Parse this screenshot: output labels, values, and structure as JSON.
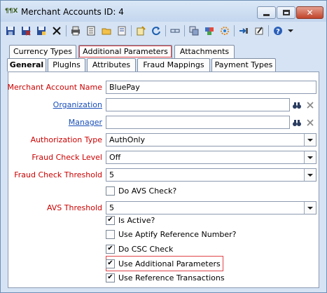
{
  "window": {
    "title": "Merchant Accounts ID: 4",
    "app_icon_text": "¶¶X",
    "minimize_icon": "minimize-icon",
    "maximize_icon": "maximize-icon",
    "close_icon": "close-icon"
  },
  "toolbar": {
    "icons": [
      "save-icon",
      "save-close-icon",
      "save-new-icon",
      "delete-icon",
      "print-icon",
      "print-preview-icon",
      "folder-open-icon",
      "notes-icon",
      "wizard-icon",
      "refresh-icon",
      "link-icon",
      "copy-icon",
      "palette-icon",
      "settings-icon",
      "attach-icon",
      "edit-icon",
      "help-icon",
      "dropdown-icon"
    ]
  },
  "tabs_top": [
    {
      "label": "Currency Types"
    },
    {
      "label": "Additional Parameters"
    },
    {
      "label": "Attachments"
    }
  ],
  "tabs_bottom": [
    {
      "label": "General"
    },
    {
      "label": "PlugIns"
    },
    {
      "label": "Attributes"
    },
    {
      "label": "Fraud Mappings"
    },
    {
      "label": "Payment Types"
    }
  ],
  "form": {
    "merchant_account_name": {
      "label": "Merchant Account Name",
      "value": "BluePay"
    },
    "organization": {
      "label": "Organization",
      "value": ""
    },
    "manager": {
      "label": "Manager",
      "value": ""
    },
    "authorization_type": {
      "label": "Authorization Type",
      "value": "AuthOnly"
    },
    "fraud_check_level": {
      "label": "Fraud Check Level",
      "value": "Off"
    },
    "fraud_check_threshold": {
      "label": "Fraud Check Threshold",
      "value": "5"
    },
    "do_avs_check": {
      "label": "Do AVS Check?",
      "checked": false
    },
    "avs_threshold": {
      "label": "AVS Threshold",
      "value": "5"
    },
    "is_active": {
      "label": "Is Active?",
      "checked": true
    },
    "use_aptify_reference_number": {
      "label": "Use Aptify Reference Number?",
      "checked": false
    },
    "do_csc_check": {
      "label": "Do CSC Check",
      "checked": true
    },
    "use_additional_parameters": {
      "label": "Use Additional Parameters",
      "checked": true
    },
    "use_reference_transactions": {
      "label": "Use Reference Transactions",
      "checked": true
    }
  },
  "colors": {
    "required_label": "#cc0000",
    "link_label": "#1a4fb8",
    "highlight": "#e0454a"
  },
  "check_glyph": "✔"
}
